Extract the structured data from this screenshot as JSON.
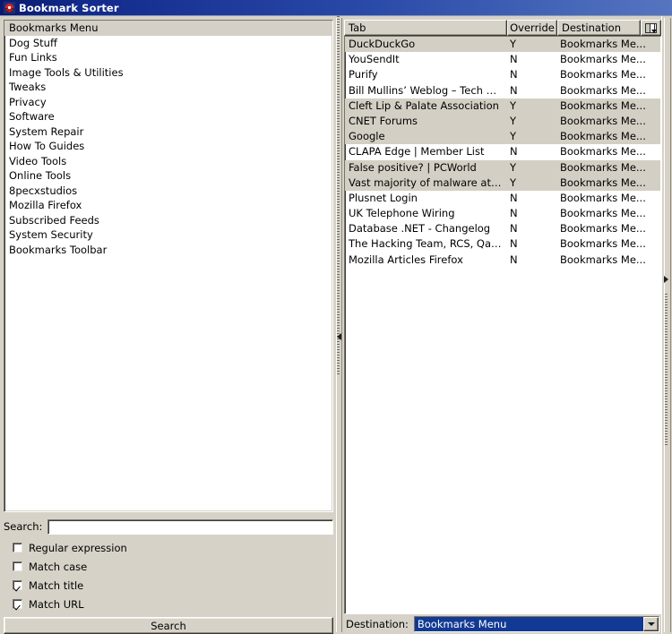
{
  "window": {
    "title": "Bookmark Sorter",
    "icon": "app-icon",
    "titlebar_color": "#122a8c"
  },
  "sidebar": {
    "name": "folder-list",
    "selected_index": 0,
    "items": [
      {
        "label": "Bookmarks Menu"
      },
      {
        "label": "Dog Stuff"
      },
      {
        "label": "Fun Links"
      },
      {
        "label": "Image Tools & Utilities"
      },
      {
        "label": "Tweaks"
      },
      {
        "label": "Privacy"
      },
      {
        "label": "Software"
      },
      {
        "label": "System Repair"
      },
      {
        "label": "How To Guides"
      },
      {
        "label": "Video Tools"
      },
      {
        "label": "Online Tools"
      },
      {
        "label": "8pecxstudios"
      },
      {
        "label": "Mozilla Firefox"
      },
      {
        "label": "Subscribed Feeds"
      },
      {
        "label": "System Security"
      },
      {
        "label": "Bookmarks Toolbar"
      }
    ]
  },
  "search": {
    "label": "Search:",
    "value": "",
    "placeholder": "",
    "options": [
      {
        "label": "Regular expression",
        "checked": false
      },
      {
        "label": "Match case",
        "checked": false
      },
      {
        "label": "Match title",
        "checked": true
      },
      {
        "label": "Match URL",
        "checked": true
      }
    ],
    "button_label": "Search"
  },
  "table": {
    "columns": [
      {
        "key": "tab",
        "label": "Tab"
      },
      {
        "key": "override",
        "label": "Override"
      },
      {
        "key": "destination",
        "label": "Destination"
      }
    ],
    "column_chooser_icon": "column-chooser-icon",
    "rows": [
      {
        "tab": "DuckDuckGo",
        "override": "Y",
        "destination": "Bookmarks Me...",
        "selected": true
      },
      {
        "tab": "YouSendIt",
        "override": "N",
        "destination": "Bookmarks Me...",
        "selected": false
      },
      {
        "tab": "Purify",
        "override": "N",
        "destination": "Bookmarks Me...",
        "selected": false
      },
      {
        "tab": "Bill Mullins’ Weblog – Tech Thoug...",
        "override": "N",
        "destination": "Bookmarks Me...",
        "selected": false
      },
      {
        "tab": "Cleft Lip & Palate Association",
        "override": "Y",
        "destination": "Bookmarks Me...",
        "selected": true
      },
      {
        "tab": "CNET Forums",
        "override": "Y",
        "destination": "Bookmarks Me...",
        "selected": true
      },
      {
        "tab": "Google",
        "override": "Y",
        "destination": "Bookmarks Me...",
        "selected": true
      },
      {
        "tab": "CLAPA Edge | Member List",
        "override": "N",
        "destination": "Bookmarks Me...",
        "selected": false
      },
      {
        "tab": "False positive? | PCWorld",
        "override": "Y",
        "destination": "Bookmarks Me...",
        "selected": true
      },
      {
        "tab": "Vast majority of malware attacks ...",
        "override": "Y",
        "destination": "Bookmarks Me...",
        "selected": true
      },
      {
        "tab": "Plusnet Login",
        "override": "N",
        "destination": "Bookmarks Me...",
        "selected": false
      },
      {
        "tab": "UK Telephone Wiring",
        "override": "N",
        "destination": "Bookmarks Me...",
        "selected": false
      },
      {
        "tab": "Database .NET - Changelog",
        "override": "N",
        "destination": "Bookmarks Me...",
        "selected": false
      },
      {
        "tab": "The Hacking Team, RCS, Qatif T...",
        "override": "N",
        "destination": "Bookmarks Me...",
        "selected": false
      },
      {
        "tab": "Mozilla Articles Firefox",
        "override": "N",
        "destination": "Bookmarks Me...",
        "selected": false
      }
    ]
  },
  "destination": {
    "label": "Destination:",
    "selected": "Bookmarks Menu"
  }
}
